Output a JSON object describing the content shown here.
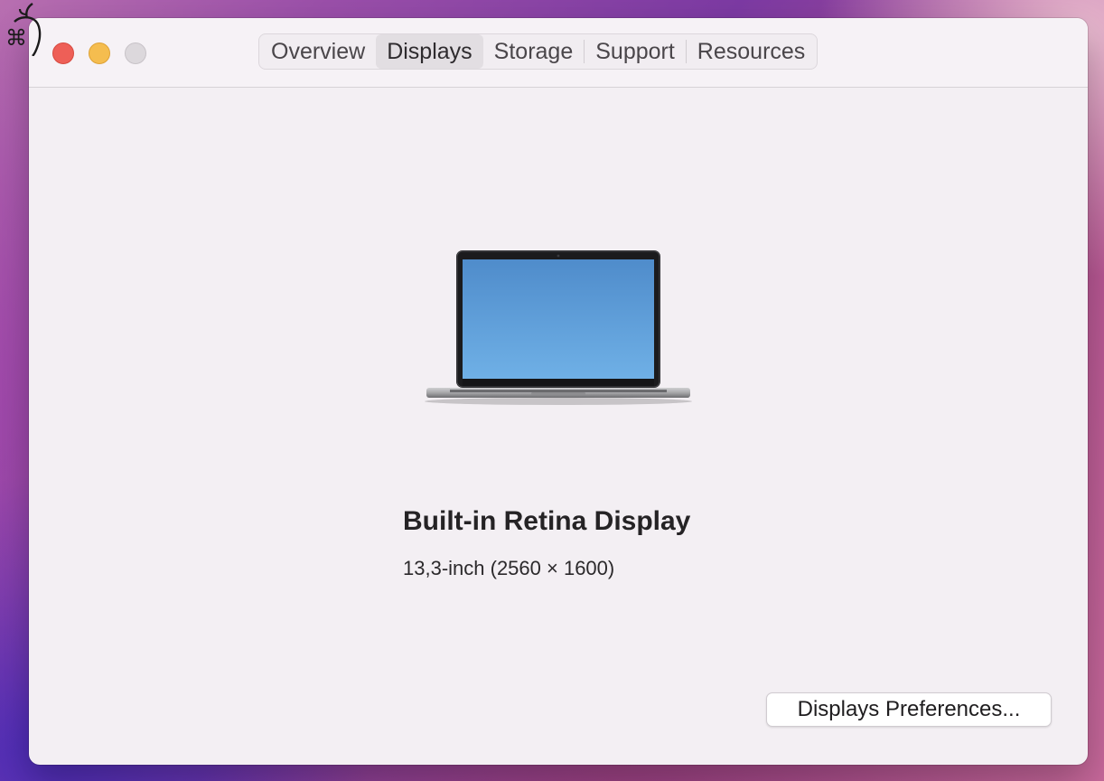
{
  "window": {
    "tabs": [
      {
        "label": "Overview",
        "active": false
      },
      {
        "label": "Displays",
        "active": true
      },
      {
        "label": "Storage",
        "active": false
      },
      {
        "label": "Support",
        "active": false
      },
      {
        "label": "Resources",
        "active": false
      }
    ]
  },
  "display": {
    "name": "Built-in Retina Display",
    "spec": "13,3-inch (2560 × 1600)",
    "image_icon": "macbook-pro-laptop"
  },
  "buttons": {
    "preferences_label": "Displays Preferences..."
  },
  "colors": {
    "close": "#ee5f57",
    "minimize": "#f5bd4f",
    "zoom": "#dcd8dc"
  }
}
